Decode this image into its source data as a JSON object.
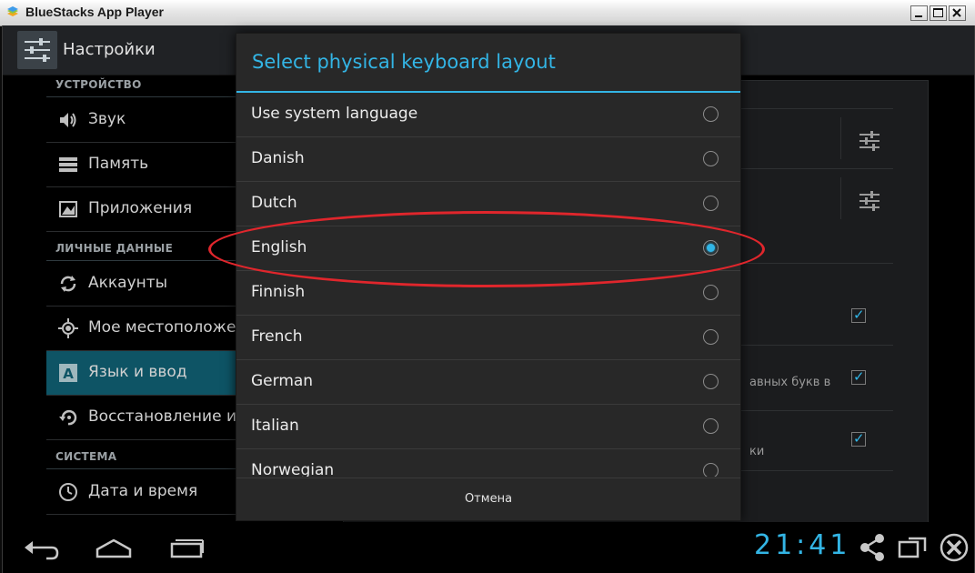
{
  "window": {
    "title": "BlueStacks App Player",
    "app_icon": "bluestacks-icon",
    "controls": [
      "minimize-icon",
      "maximize-icon",
      "close-icon"
    ]
  },
  "actionbar": {
    "icon": "settings-icon",
    "title": "Настройки"
  },
  "settings_list": {
    "sections": [
      {
        "header": "УСТРОЙСТВО",
        "items": [
          {
            "label": "Звук",
            "icon": "speaker-icon"
          },
          {
            "label": "Память",
            "icon": "storage-icon"
          },
          {
            "label": "Приложения",
            "icon": "apps-icon"
          }
        ]
      },
      {
        "header": "ЛИЧНЫЕ ДАННЫЕ",
        "items": [
          {
            "label": "Аккаунты",
            "icon": "sync-icon"
          },
          {
            "label": "Мое местоположен",
            "icon": "location-icon"
          },
          {
            "label": "Язык и ввод",
            "icon": "language-icon",
            "selected": true
          },
          {
            "label": "Восстановление и с",
            "icon": "backup-icon"
          }
        ]
      },
      {
        "header": "СИСТЕМА",
        "items": [
          {
            "label": "Дата и время",
            "icon": "clock-icon"
          }
        ]
      }
    ]
  },
  "background_panel": {
    "text_fragment_1": "авных букв в",
    "text_fragment_2": "ки",
    "checkboxes_checked": [
      true,
      true,
      true
    ]
  },
  "dialog": {
    "title": "Select physical keyboard layout",
    "options": [
      {
        "label": "Use system language",
        "checked": false
      },
      {
        "label": "Danish",
        "checked": false
      },
      {
        "label": "Dutch",
        "checked": false
      },
      {
        "label": "English",
        "checked": true
      },
      {
        "label": "Finnish",
        "checked": false
      },
      {
        "label": "French",
        "checked": false
      },
      {
        "label": "German",
        "checked": false
      },
      {
        "label": "Italian",
        "checked": false
      },
      {
        "label": "Norwegian",
        "checked": false
      }
    ],
    "cancel_label": "Отмена",
    "accent_color": "#33b5e5"
  },
  "annotation": {
    "highlights": "English",
    "color": "#e0262c"
  },
  "navbar": {
    "buttons": [
      "back-icon",
      "home-icon",
      "recent-apps-icon"
    ],
    "clock": "21:41",
    "right_icons": [
      "share-icon",
      "screen-mode-icon",
      "exit-icon"
    ]
  }
}
